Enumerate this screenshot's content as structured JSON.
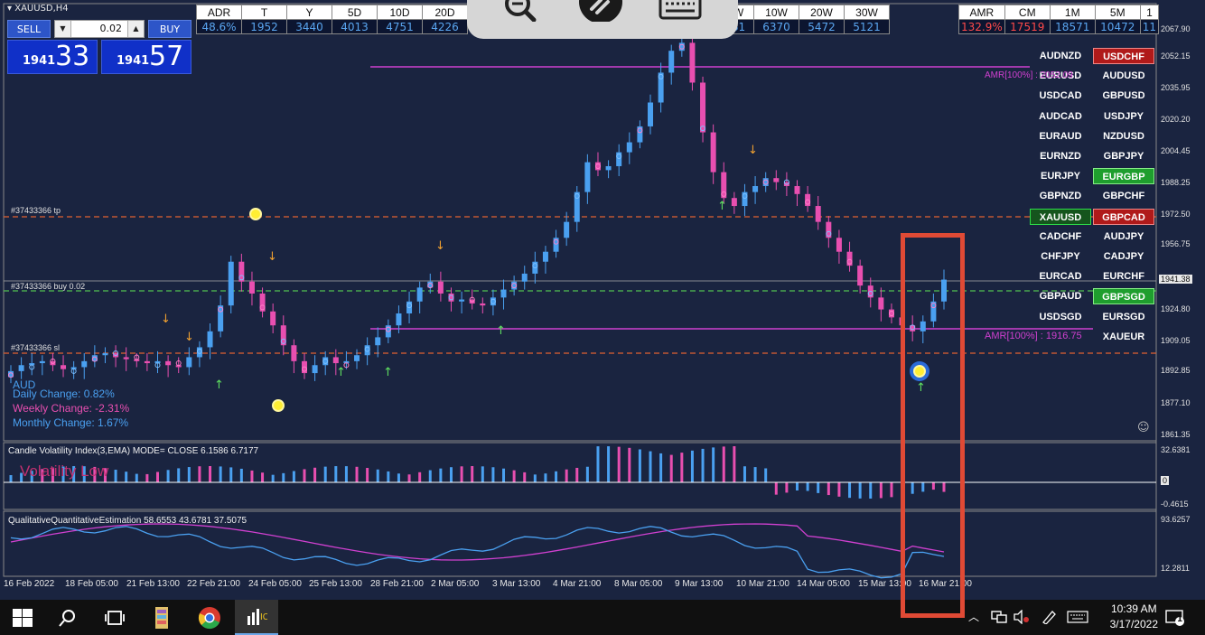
{
  "window": {
    "title": "XAUUSD,H4"
  },
  "trade_panel": {
    "sell_label": "SELL",
    "buy_label": "BUY",
    "lot_value": "0.02",
    "bid_small": "1941",
    "bid_big": "33",
    "ask_small": "1941",
    "ask_big": "57"
  },
  "ranges_table": {
    "headers": [
      "ADR",
      "T",
      "Y",
      "5D",
      "10D",
      "20D"
    ],
    "values": [
      "48.6%",
      "1952",
      "3440",
      "4013",
      "4751",
      "4226"
    ]
  },
  "weekly_table": {
    "headers": [
      "W",
      "10W",
      "20W",
      "30W"
    ],
    "values": [
      "81",
      "6370",
      "5472",
      "5121"
    ]
  },
  "amr_table": {
    "headers": [
      "AMR",
      "CM",
      "1M",
      "5M",
      "1"
    ],
    "values": [
      "132.9%",
      "17519",
      "18571",
      "10472",
      "11"
    ]
  },
  "pairs": [
    [
      "AUDNZD",
      "USDCHF"
    ],
    [
      "EURUSD",
      "AUDUSD"
    ],
    [
      "USDCAD",
      "GBPUSD"
    ],
    [
      "AUDCAD",
      "USDJPY"
    ],
    [
      "EURAUD",
      "NZDUSD"
    ],
    [
      "EURNZD",
      "GBPJPY"
    ],
    [
      "EURJPY",
      "EURGBP"
    ],
    [
      "GBPNZD",
      "GBPCHF"
    ],
    [
      "XAUUSD",
      "GBPCAD"
    ],
    [
      "CADCHF",
      "AUDJPY"
    ],
    [
      "CHFJPY",
      "CADJPY"
    ],
    [
      "EURCAD",
      "EURCHF"
    ],
    [
      "GBPAUD",
      "GBPSGD"
    ],
    [
      "USDSGD",
      "EURSGD"
    ],
    [
      "",
      "XAUEUR"
    ]
  ],
  "chart_labels": {
    "tp_label": "#37433366 tp",
    "buy_label": "#37433366 buy 0.02",
    "sl_label": "#37433366 sl",
    "amr_top": "AMR[100%] : 2052.09",
    "amr_bottom": "AMR[100%] : 1916.75",
    "current_price": "1941.38"
  },
  "info": {
    "line0": "AUD",
    "line1": "Daily Change: 0.82%",
    "line2": "Weekly Change: -2.31%",
    "line3": "Monthly Change: 1.67%"
  },
  "price_axis": [
    "2067.90",
    "2052.15",
    "2035.95",
    "2020.20",
    "2004.45",
    "1988.25",
    "1972.50",
    "1956.75",
    "1941.38",
    "1924.80",
    "1909.05",
    "1892.85",
    "1877.10",
    "1861.35"
  ],
  "indicator1": {
    "title": "Candle Volatility Index(3,EMA) MODE= CLOSE 6.1586 6.7177",
    "watermark": "Volatility Low",
    "axis_top": "32.6381",
    "axis_zero": "0",
    "axis_bottom": "-0.4615"
  },
  "indicator2": {
    "title": "QualitativeQuantitativeEstimation 58.6553 43.6781 37.5075",
    "axis_top": "93.6257",
    "axis_bottom": "12.2811"
  },
  "date_axis": [
    "16 Feb 2022",
    "18 Feb 05:00",
    "21 Feb 13:00",
    "22 Feb 21:00",
    "24 Feb 05:00",
    "25 Feb 13:00",
    "28 Feb 21:00",
    "2 Mar 05:00",
    "3 Mar 13:00",
    "4 Mar 21:00",
    "8 Mar 05:00",
    "9 Mar 13:00",
    "10 Mar 21:00",
    "14 Mar 05:00",
    "15 Mar 13:00",
    "16 Mar 21:00"
  ],
  "taskbar": {
    "time": "10:39 AM",
    "date": "3/17/2022",
    "notification_count": "1"
  },
  "colors": {
    "chart_bg": "#1a2440",
    "bull": "#4aa0f0",
    "bear": "#e84fb0",
    "amr_line": "#d040d0",
    "tp_sl_line": "#e06030",
    "buy_line": "#50c050",
    "highlight": "#e04a35"
  },
  "chart_data": {
    "type": "candlestick",
    "symbol": "XAUUSD",
    "timeframe": "H4",
    "ylim": [
      1861.35,
      2067.9
    ],
    "close_path": [
      1895,
      1898,
      1899,
      1900,
      1898,
      1896,
      1897,
      1900,
      1903,
      1904,
      1902,
      1901,
      1900,
      1899,
      1900,
      1898,
      1897,
      1902,
      1907,
      1915,
      1928,
      1950,
      1940,
      1934,
      1925,
      1918,
      1908,
      1900,
      1894,
      1898,
      1902,
      1899,
      1900,
      1903,
      1908,
      1912,
      1918,
      1924,
      1930,
      1937,
      1940,
      1934,
      1930,
      1931,
      1929,
      1928,
      1932,
      1936,
      1940,
      1944,
      1950,
      1955,
      1962,
      1970,
      1985,
      2000,
      1996,
      1998,
      2005,
      2010,
      2018,
      2030,
      2045,
      2056,
      2060,
      2040,
      2015,
      1995,
      1982,
      1978,
      1985,
      1988,
      1992,
      1990,
      1988,
      1984,
      1978,
      1970,
      1962,
      1955,
      1948,
      1938,
      1932,
      1926,
      1922,
      1918,
      1915,
      1920,
      1930,
      1941
    ]
  }
}
